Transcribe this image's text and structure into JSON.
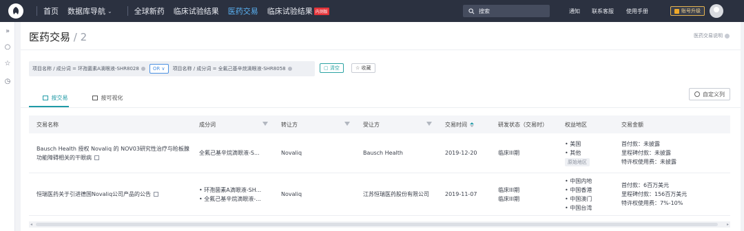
{
  "topnav": {
    "logo_icon": "app-logo-icon",
    "items": [
      {
        "label": "首页",
        "active": false
      },
      {
        "label": "数据库导航",
        "active": false,
        "dropdown": true
      },
      {
        "label": "全球新药",
        "active": false
      },
      {
        "label": "临床试验结果",
        "active": false
      },
      {
        "label": "医药交易",
        "active": true
      },
      {
        "label": "临床试验结果",
        "active": false,
        "badge": "内测版"
      }
    ],
    "search_placeholder": "搜索",
    "links": [
      "通知",
      "联系客服",
      "使用手册"
    ],
    "upgrade_label": "账号升级"
  },
  "rail": {
    "icons": [
      "expand-icon",
      "chat-icon",
      "star-icon",
      "clock-icon"
    ]
  },
  "page": {
    "title": "医药交易",
    "count": "/ 2",
    "help_label": "医药交易说明"
  },
  "filters": {
    "chip1": "项目名称 / 成分词 = 环孢菌素A滴眼液-SHR8028",
    "operator": "OR",
    "chip2": "项目名称 / 成分词 = 全氟己基辛烷滴眼液-SHR8058",
    "clear_label": "清空",
    "favorite_label": "收藏"
  },
  "tabs": [
    {
      "label": "按交易",
      "active": true
    },
    {
      "label": "按可视化",
      "active": false
    }
  ],
  "custom_columns_label": "自定义列",
  "table": {
    "headers": [
      "交易名称",
      "成分词",
      "转让方",
      "受让方",
      "交易时间",
      "研发状态（交易时）",
      "权益地区",
      "交易金额"
    ],
    "rows": [
      {
        "name": "Bausch Health 授权 Novaliq 的 NOV03研究性治疗与睑板腺功能障碍相关的干眼病",
        "ingredients": [
          "全氟己基辛烷滴眼液-S..."
        ],
        "transferor": "Novaliq",
        "transferee": "Bausch Health",
        "date": "2019-12-20",
        "status": [
          "临床III期"
        ],
        "regions": [
          "美国",
          "其他"
        ],
        "region_tag": "原始地区",
        "amounts": [
          "首付款：未披露",
          "里程碑付款：未披露",
          "特许权使用费：未披露"
        ]
      },
      {
        "name": "恒瑞医药关于引进德国Novaliq公司产品的公告",
        "ingredients": [
          "环孢菌素A滴眼液-SH...",
          "全氟己基辛烷滴眼液-..."
        ],
        "transferor": "Novaliq",
        "transferee": "江苏恒瑞医药股份有限公司",
        "date": "2019-11-07",
        "status": [
          "临床III期",
          "临床III期"
        ],
        "regions": [
          "中国内地",
          "中国香港",
          "中国澳门",
          "中国台湾"
        ],
        "region_tag": "",
        "amounts": [
          "首付款：6百万美元",
          "里程碑付款：156百万美元",
          "特许权使用费：7%-10%"
        ]
      }
    ]
  },
  "colors": {
    "nav_bg": "#2b3140",
    "accent": "#1f9aa6",
    "nav_active": "#5ab3f5"
  }
}
